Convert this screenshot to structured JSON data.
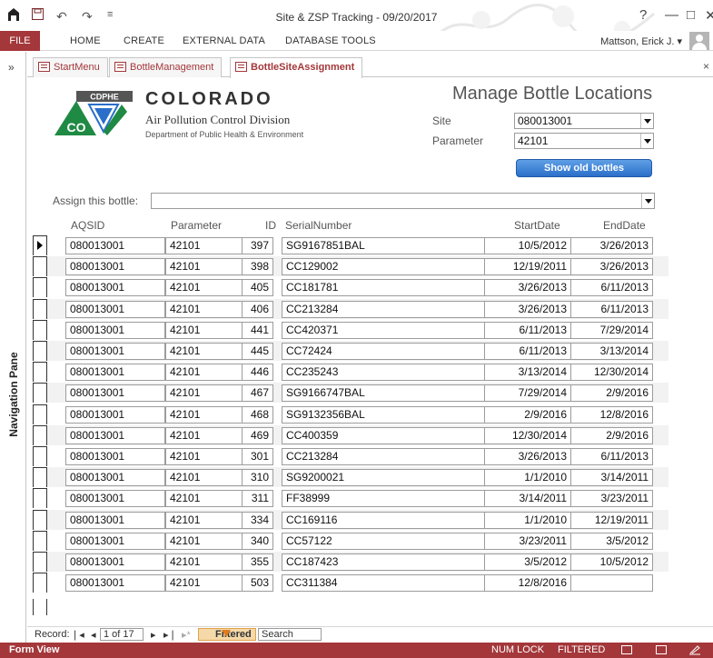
{
  "window": {
    "title": "Site & ZSP Tracking - 09/20/2017",
    "user": "Mattson, Erick J. ▾",
    "help": "?",
    "minimize": "—",
    "restore": "□",
    "close": "✕"
  },
  "quick_access": {
    "undo": "↶",
    "redo": "↷",
    "more": "≡"
  },
  "ribbon": {
    "file": "FILE",
    "tabs": [
      "HOME",
      "CREATE",
      "EXTERNAL DATA",
      "DATABASE TOOLS"
    ]
  },
  "nav_pane": {
    "label": "Navigation Pane",
    "toggle": "»"
  },
  "doc_tabs": [
    "StartMenu",
    "BottleManagement",
    "BottleSiteAssignment"
  ],
  "doc_close": "×",
  "header": {
    "logo_text": "CDPHE",
    "logo_co": "CO",
    "org_word": "COLORADO",
    "division": "Air Pollution Control Division",
    "department": "Department of Public Health & Environment"
  },
  "form": {
    "title": "Manage Bottle Locations",
    "site_label": "Site",
    "site_value": "080013001",
    "parameter_label": "Parameter",
    "parameter_value": "42101",
    "show_old_button": "Show old bottles",
    "assign_label": "Assign this bottle:",
    "assign_value": ""
  },
  "grid": {
    "columns": [
      "AQSID",
      "Parameter",
      "ID",
      "SerialNumber",
      "StartDate",
      "EndDate"
    ],
    "rows": [
      [
        "080013001",
        "42101",
        "397",
        "SG9167851BAL",
        "10/5/2012",
        "3/26/2013"
      ],
      [
        "080013001",
        "42101",
        "398",
        "CC129002",
        "12/19/2011",
        "3/26/2013"
      ],
      [
        "080013001",
        "42101",
        "405",
        "CC181781",
        "3/26/2013",
        "6/11/2013"
      ],
      [
        "080013001",
        "42101",
        "406",
        "CC213284",
        "3/26/2013",
        "6/11/2013"
      ],
      [
        "080013001",
        "42101",
        "441",
        "CC420371",
        "6/11/2013",
        "7/29/2014"
      ],
      [
        "080013001",
        "42101",
        "445",
        "CC72424",
        "6/11/2013",
        "3/13/2014"
      ],
      [
        "080013001",
        "42101",
        "446",
        "CC235243",
        "3/13/2014",
        "12/30/2014"
      ],
      [
        "080013001",
        "42101",
        "467",
        "SG9166747BAL",
        "7/29/2014",
        "2/9/2016"
      ],
      [
        "080013001",
        "42101",
        "468",
        "SG9132356BAL",
        "2/9/2016",
        "12/8/2016"
      ],
      [
        "080013001",
        "42101",
        "469",
        "CC400359",
        "12/30/2014",
        "2/9/2016"
      ],
      [
        "080013001",
        "42101",
        "301",
        "CC213284",
        "3/26/2013",
        "6/11/2013"
      ],
      [
        "080013001",
        "42101",
        "310",
        "SG9200021",
        "1/1/2010",
        "3/14/2011"
      ],
      [
        "080013001",
        "42101",
        "311",
        "FF38999",
        "3/14/2011",
        "3/23/2011"
      ],
      [
        "080013001",
        "42101",
        "334",
        "CC169116",
        "1/1/2010",
        "12/19/2011"
      ],
      [
        "080013001",
        "42101",
        "340",
        "CC57122",
        "3/23/2011",
        "3/5/2012"
      ],
      [
        "080013001",
        "42101",
        "355",
        "CC187423",
        "3/5/2012",
        "10/5/2012"
      ],
      [
        "080013001",
        "42101",
        "503",
        "CC311384",
        "12/8/2016",
        ""
      ]
    ]
  },
  "record_nav": {
    "label": "Record:",
    "first": "❘◂",
    "prev": "◂",
    "position": "1 of 17",
    "next": "▸",
    "last": "▸❘",
    "new": "▸*",
    "filter": "Filtered",
    "search": "Search"
  },
  "status": {
    "view": "Form View",
    "numlock": "NUM LOCK",
    "filtered": "FILTERED"
  },
  "colors": {
    "accent": "#a4373a",
    "button": "#2a6fc9"
  }
}
